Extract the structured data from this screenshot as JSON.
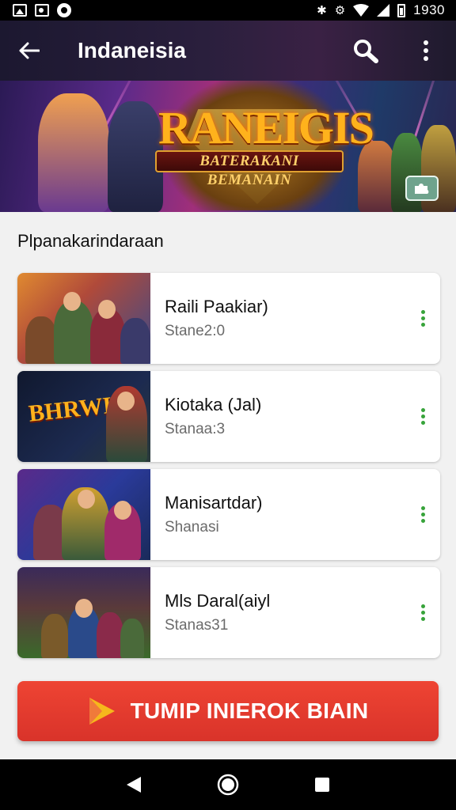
{
  "status_bar": {
    "time": "1930",
    "icons": [
      "gallery-icon",
      "image-icon",
      "notification-icon",
      "bluetooth-icon",
      "vibrate-icon",
      "wifi-icon",
      "signal-icon",
      "battery-icon"
    ]
  },
  "app_bar": {
    "title": "Indaneisia",
    "back_icon": "arrow-left-icon",
    "search_icon": "search-icon",
    "menu_icon": "more-vert-icon"
  },
  "banner": {
    "title": "RANEIGIS",
    "subtitle": "BATERAKANI BEMANAIN",
    "badge_icon": "puzzle-icon"
  },
  "section": {
    "title": "Plpanakarindaraan"
  },
  "games": [
    {
      "name": "Raili Paakiar)",
      "subtitle": "Stane2:0",
      "thumb_text": ""
    },
    {
      "name": "Kiotaka (Jal)",
      "subtitle": "Stanaa:3",
      "thumb_text": "BHRWIA"
    },
    {
      "name": "Manisartdar)",
      "subtitle": "Shanasi",
      "thumb_text": ""
    },
    {
      "name": "Mls Daral(aiyl",
      "subtitle": "Stanas31",
      "thumb_text": ""
    }
  ],
  "cta": {
    "label": "TUMIP INIEROK BIAIN",
    "icon": "play-icon"
  },
  "nav_bar": {
    "icons": [
      "back-triangle-icon",
      "home-circle-icon",
      "recents-square-icon"
    ]
  },
  "colors": {
    "accent_red": "#e03a2e",
    "menu_dots_green": "#37a33a",
    "app_bar_bg": "#221c35"
  }
}
